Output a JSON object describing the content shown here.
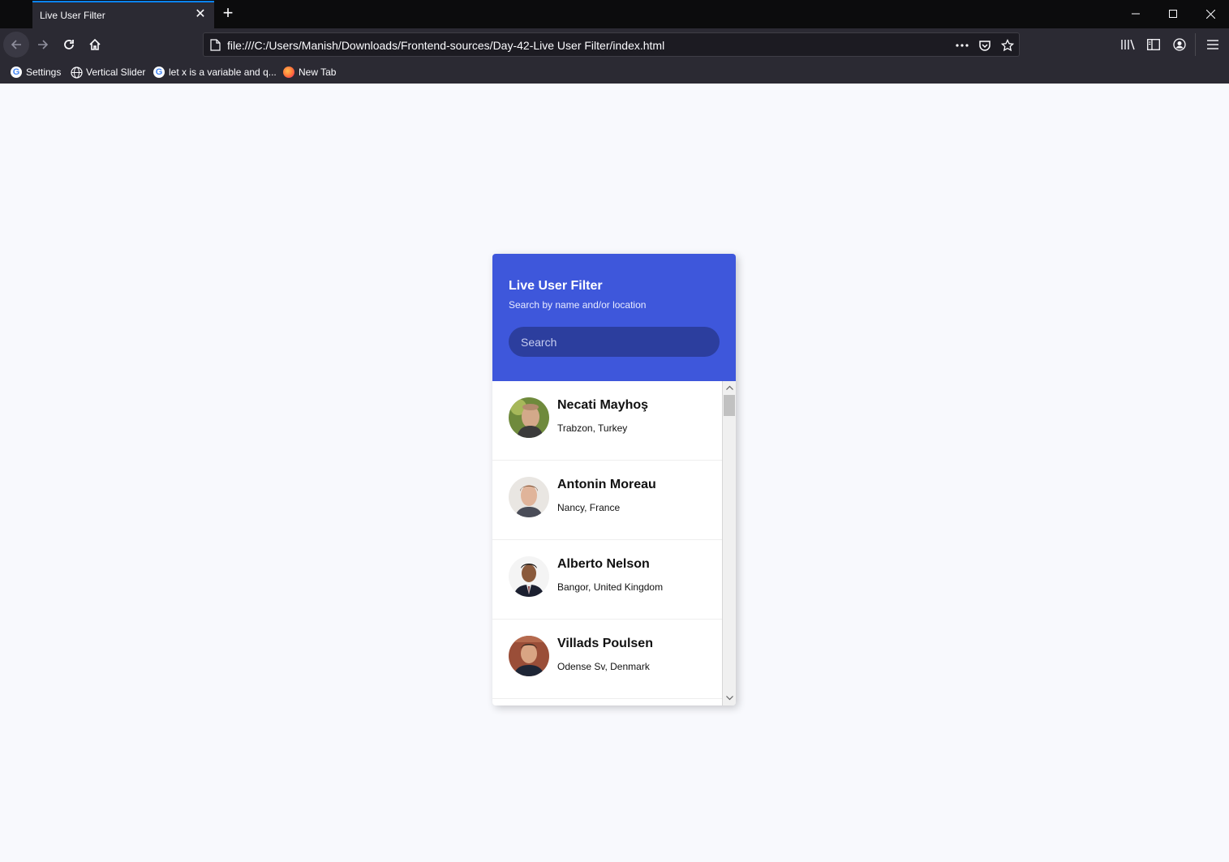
{
  "browser": {
    "tab_title": "Live User Filter",
    "url": "file:///C:/Users/Manish/Downloads/Frontend-sources/Day-42-Live User Filter/index.html",
    "bookmarks": [
      {
        "label": "Settings",
        "icon": "google-icon"
      },
      {
        "label": "Vertical Slider",
        "icon": "globe-icon"
      },
      {
        "label": "let x is a variable and q...",
        "icon": "google-icon"
      },
      {
        "label": "New Tab",
        "icon": "firefox-icon"
      }
    ]
  },
  "app": {
    "title": "Live User Filter",
    "subtitle": "Search by name and/or location",
    "search_placeholder": "Search",
    "header_color": "#3e57db",
    "search_bg": "#2c3e9e",
    "users": [
      {
        "name": "Necati Mayhoş",
        "location": "Trabzon, Turkey"
      },
      {
        "name": "Antonin Moreau",
        "location": "Nancy, France"
      },
      {
        "name": "Alberto Nelson",
        "location": "Bangor, United Kingdom"
      },
      {
        "name": "Villads Poulsen",
        "location": "Odense Sv, Denmark"
      }
    ]
  }
}
